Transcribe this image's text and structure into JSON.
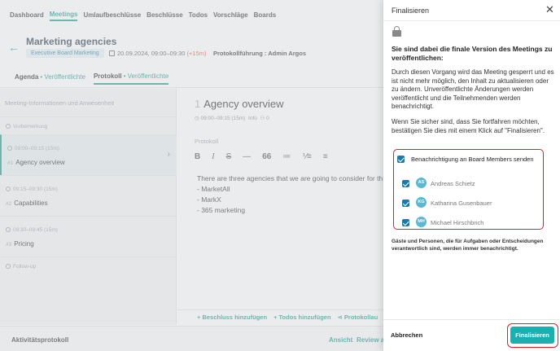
{
  "nav": {
    "items": [
      "Dashboard",
      "Meetings",
      "Umlaufbeschlüsse",
      "Beschlüsse",
      "Todos",
      "Vorschläge",
      "Boards"
    ],
    "active": "Meetings"
  },
  "meeting": {
    "title": "Marketing agencies",
    "board": "Executive Board Marketing",
    "date": "20.09.2024, 09:00–09:30",
    "late": "(+15m)",
    "protokollfuehrung": "Protokollführung : Admin Argos"
  },
  "subtabs": {
    "agenda_label": "Agenda",
    "agenda_status": "Veröffentlichte",
    "protokoll_label": "Protokoll",
    "protokoll_status": "Veröffentlichte"
  },
  "agenda": {
    "info": "Meeting-Informationen und Anwesenheit",
    "items": [
      {
        "time": "Vorbemerkung",
        "num": "",
        "title": ""
      },
      {
        "time": "09:00–09:15 (15m)",
        "num": "#1",
        "title": "Agency overview"
      },
      {
        "time": "09:15–09:30 (15m)",
        "num": "#2",
        "title": "Capabilities"
      },
      {
        "time": "09:30–09:45 (15m)",
        "num": "#3",
        "title": "Pricing"
      },
      {
        "time": "Follow-up",
        "num": "",
        "title": ""
      }
    ]
  },
  "item": {
    "index": "1",
    "title": "Agency overview",
    "time": "09:00–09:15 (15m)",
    "info": "Info",
    "count": "0",
    "protokoll_label": "Protokoll",
    "toolbar": [
      "B",
      "I",
      "S",
      "—",
      "66",
      "≔",
      "⅟≡",
      "≡"
    ],
    "lines": [
      "There are three agencies that we are going to consider for th",
      "- MarketAll",
      "- MarkX",
      "- 365 marketing"
    ]
  },
  "actions": {
    "beschluss": "+ Beschluss hinzufügen",
    "todos": "+ Todos hinzufügen",
    "protokoll": "Protokollau"
  },
  "footer": {
    "log": "Aktivitätsprotokoll",
    "ansicht": "Ansicht",
    "review": "Review an"
  },
  "drawer": {
    "title": "Finalisieren",
    "headline": "Sie sind dabei die finale Version des Meetings zu veröffentlichen:",
    "para1": "Durch diesen Vorgang wird das Meeting gesperrt und es ist nicht mehr möglich, den Inhalt zu aktualisieren oder zu ändern. Unveröffentlichte Änderungen werden veröffentlicht und die Teilnehmenden werden benachrichtigt.",
    "para2": "Wenn Sie sicher sind, dass Sie fortfahren möchten, bestätigen Sie dies mit einem Klick auf \"Finalisieren\".",
    "notify_label": "Benachrichtigung an Board Members senden",
    "members": [
      {
        "initials": "AS",
        "name": "Andreas Schietz",
        "checked": true
      },
      {
        "initials": "KG",
        "name": "Katharina Gusenbauer",
        "checked": true
      },
      {
        "initials": "MH",
        "name": "Michael Hirschbrich",
        "checked": true
      }
    ],
    "guest_note": "Gäste und Personen, die für Aufgaben oder Entscheidungen verantwortlich sind, werden immer benachrichtigt.",
    "cancel_label": "Abbrechen",
    "finalize_label": "Finalisieren"
  },
  "colors": {
    "accent": "#1a9c8c",
    "button": "#1ab0b0",
    "checkbox": "#1a7aa8",
    "highlight": "#e02020",
    "late": "#e05c3a"
  }
}
